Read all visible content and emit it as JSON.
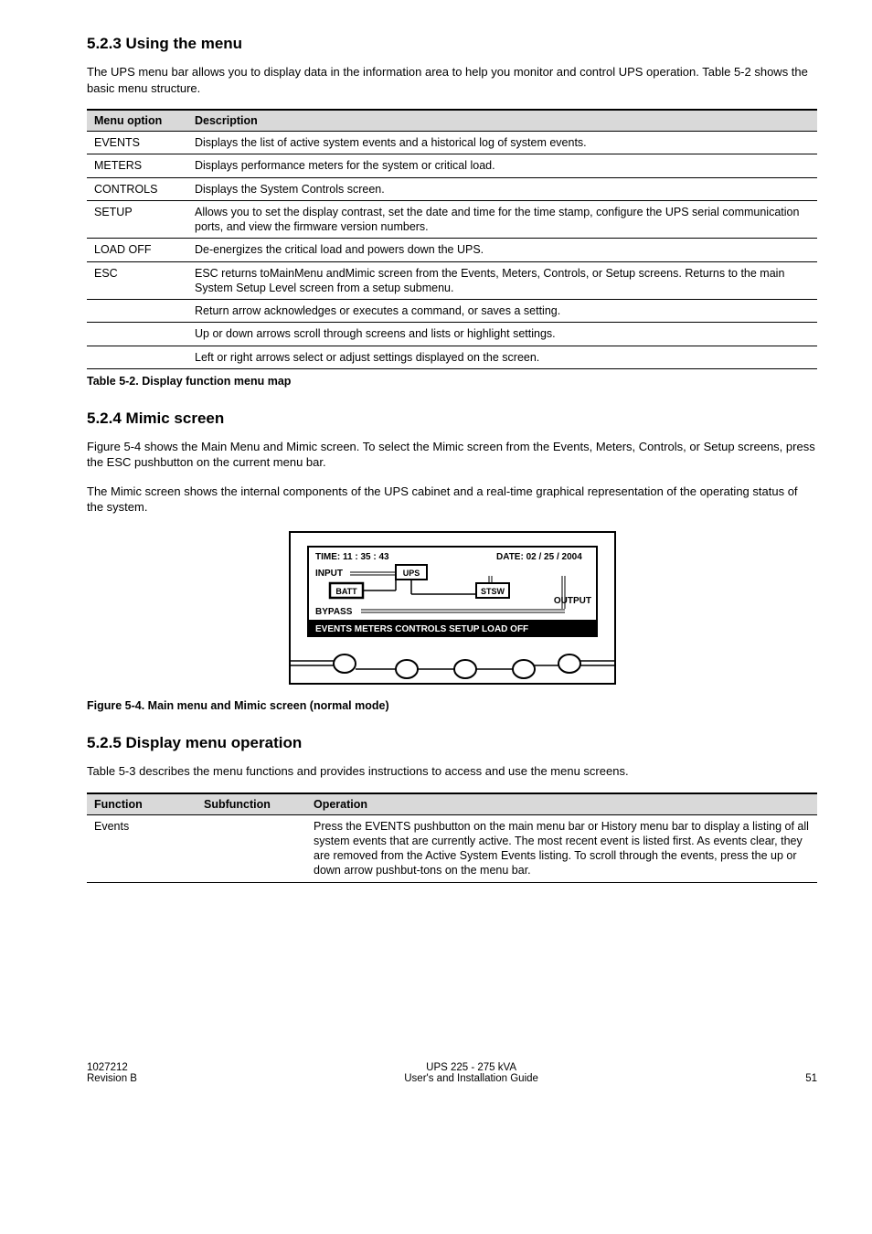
{
  "section1": {
    "heading": "5.2.3 Using the menu",
    "para": "The UPS menu bar allows you to display data in the information area to help you monitor and control UPS operation. Table 5-2 shows the basic menu structure."
  },
  "table1": {
    "headers": {
      "c1": "Menu option",
      "c2": "Description"
    },
    "rows": [
      {
        "opt": "EVENTS",
        "desc": "Displays the list of active system events and a historical log of system events."
      },
      {
        "opt": "METERS",
        "desc": "Displays performance meters for the system or critical load."
      },
      {
        "opt": "CONTROLS",
        "desc": "Displays the System Controls screen."
      },
      {
        "opt": "SETUP",
        "desc": "Allows you to set the display contrast, set the date and time for the time stamp, configure the UPS serial communication ports, and view the firmware version numbers."
      },
      {
        "opt": "LOAD OFF",
        "desc": "De-energizes the critical load and powers down the UPS."
      },
      {
        "opt": "ESC",
        "desc": "ESC returns toMainMenu andMimic screen from the Events, Meters, Controls, or Setup screens. Returns to the main System Setup Level screen from a setup submenu."
      },
      {
        "opt": "",
        "desc": "Return arrow acknowledges or executes a command, or saves a setting."
      },
      {
        "opt": "",
        "desc": "Up or down arrows scroll through screens and lists or highlight settings."
      },
      {
        "opt": "",
        "desc": "Left or right arrows select or adjust settings displayed on the screen."
      }
    ],
    "caption": "Table 5-2. Display function menu map"
  },
  "section2": {
    "heading": "5.2.4 Mimic screen",
    "para1": "Figure 5-4 shows the Main Menu and Mimic screen. To select the Mimic screen from the Events, Meters, Controls, or Setup screens, press the ESC pushbutton on the current menu bar.",
    "para2": "The Mimic screen shows the internal components of the UPS cabinet and a real-time graphical representation of the operating status of the system."
  },
  "figure": {
    "time_label": "TIME:  11 : 35 : 43",
    "date_label": "DATE:  02 / 25 / 2004",
    "input": "INPUT",
    "ups": "UPS",
    "batt": "BATT",
    "stsw": "STSW",
    "output": "OUTPUT",
    "bypass": "BYPASS",
    "menubar": "EVENTS  METERS  CONTROLS  SETUP    LOAD OFF",
    "caption": "Figure 5-4. Main menu and Mimic screen (normal mode)"
  },
  "section3": {
    "heading": "5.2.5 Display menu operation",
    "para": "Table 5-3 describes the menu functions and provides instructions to access and use the menu screens."
  },
  "table2": {
    "headers": {
      "c1": "Function",
      "c2": "Subfunction",
      "c3": "Operation"
    },
    "rows": [
      {
        "fn": "Events",
        "sub": "",
        "op": "Press the EVENTS pushbutton on the main menu bar or History menu bar to display a listing of all system events that are currently active. The most recent event is listed first. As events clear, they are removed from the Active System Events listing. To scroll through the events, press the up or down arrow pushbut-tons on the menu bar."
      }
    ]
  },
  "footer": {
    "left1": "1027212",
    "left2": "Revision B",
    "center1": "UPS 225 - 275 kVA",
    "center2": "User's and Installation Guide",
    "right": "51"
  }
}
